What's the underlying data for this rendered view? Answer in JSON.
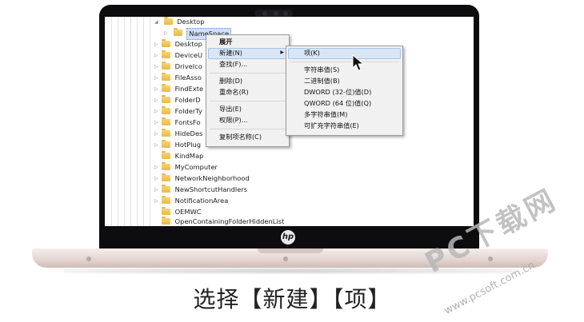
{
  "tree": {
    "parent_label": "Desktop",
    "rows": [
      {
        "label": "NameSpace",
        "selected": true
      },
      {
        "label": "Desktop"
      },
      {
        "label": "DeviceU"
      },
      {
        "label": "DriveIco"
      },
      {
        "label": "FileAsso"
      },
      {
        "label": "FindExte"
      },
      {
        "label": "FolderD"
      },
      {
        "label": "FolderTy"
      },
      {
        "label": "FontsFo"
      },
      {
        "label": "HideDes"
      },
      {
        "label": "HotPlug"
      },
      {
        "label": "KindMap"
      },
      {
        "label": "MyComputer"
      },
      {
        "label": "NetworkNeighborhood"
      },
      {
        "label": "NewShortcutHandlers"
      },
      {
        "label": "NotificationArea"
      },
      {
        "label": "OEMWC"
      },
      {
        "label": "OpenContainingFolderHiddenList"
      }
    ]
  },
  "context_menu": {
    "expand": "展开",
    "new": "新建(N)",
    "find": "查找(F)...",
    "delete": "删除(D)",
    "rename": "重命名(R)",
    "export": "导出(E)",
    "permissions": "权限(P)...",
    "copy_key_name": "复制项名称(C)"
  },
  "submenu": {
    "key": "项(K)",
    "string_value": "字符串值(S)",
    "binary_value": "二进制值(B)",
    "dword_value": "DWORD (32-位)值(D)",
    "qword_value": "QWORD (64 位)值(Q)",
    "multi_string_value": "多字符串值(M)",
    "expandable_string_value": "可扩充字符串值(E)"
  },
  "caption": "选择【新建】【项】",
  "watermark": {
    "title": "PC下载网",
    "url": "www.pcsoft.com.cn"
  },
  "icons": {
    "brand_logo": "hp-logo-icon",
    "pointer": "mouse-cursor-icon",
    "submenu_arrow": "chevron-right-icon",
    "folder": "folder-icon"
  },
  "colors": {
    "menu_highlight": "#d9e6f6",
    "folder": "#f6d56a",
    "bezel": "#0d0d0f",
    "laptop_base": "#e2d4cf"
  }
}
